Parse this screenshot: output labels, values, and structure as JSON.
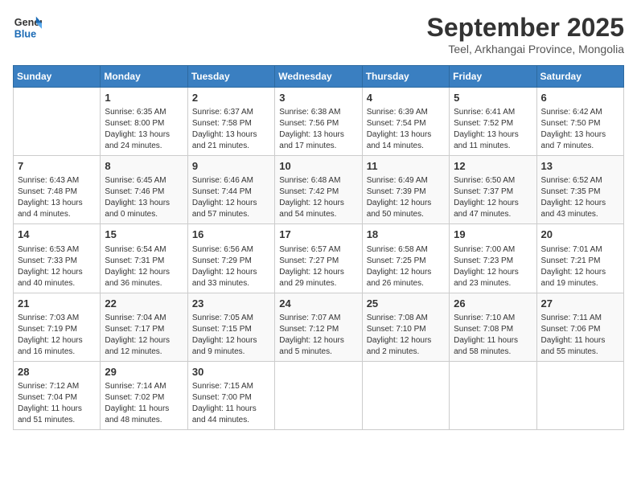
{
  "header": {
    "logo_line1": "General",
    "logo_line2": "Blue",
    "month_title": "September 2025",
    "location": "Teel, Arkhangai Province, Mongolia"
  },
  "weekdays": [
    "Sunday",
    "Monday",
    "Tuesday",
    "Wednesday",
    "Thursday",
    "Friday",
    "Saturday"
  ],
  "weeks": [
    [
      {
        "day": "",
        "info": ""
      },
      {
        "day": "1",
        "info": "Sunrise: 6:35 AM\nSunset: 8:00 PM\nDaylight: 13 hours\nand 24 minutes."
      },
      {
        "day": "2",
        "info": "Sunrise: 6:37 AM\nSunset: 7:58 PM\nDaylight: 13 hours\nand 21 minutes."
      },
      {
        "day": "3",
        "info": "Sunrise: 6:38 AM\nSunset: 7:56 PM\nDaylight: 13 hours\nand 17 minutes."
      },
      {
        "day": "4",
        "info": "Sunrise: 6:39 AM\nSunset: 7:54 PM\nDaylight: 13 hours\nand 14 minutes."
      },
      {
        "day": "5",
        "info": "Sunrise: 6:41 AM\nSunset: 7:52 PM\nDaylight: 13 hours\nand 11 minutes."
      },
      {
        "day": "6",
        "info": "Sunrise: 6:42 AM\nSunset: 7:50 PM\nDaylight: 13 hours\nand 7 minutes."
      }
    ],
    [
      {
        "day": "7",
        "info": "Sunrise: 6:43 AM\nSunset: 7:48 PM\nDaylight: 13 hours\nand 4 minutes."
      },
      {
        "day": "8",
        "info": "Sunrise: 6:45 AM\nSunset: 7:46 PM\nDaylight: 13 hours\nand 0 minutes."
      },
      {
        "day": "9",
        "info": "Sunrise: 6:46 AM\nSunset: 7:44 PM\nDaylight: 12 hours\nand 57 minutes."
      },
      {
        "day": "10",
        "info": "Sunrise: 6:48 AM\nSunset: 7:42 PM\nDaylight: 12 hours\nand 54 minutes."
      },
      {
        "day": "11",
        "info": "Sunrise: 6:49 AM\nSunset: 7:39 PM\nDaylight: 12 hours\nand 50 minutes."
      },
      {
        "day": "12",
        "info": "Sunrise: 6:50 AM\nSunset: 7:37 PM\nDaylight: 12 hours\nand 47 minutes."
      },
      {
        "day": "13",
        "info": "Sunrise: 6:52 AM\nSunset: 7:35 PM\nDaylight: 12 hours\nand 43 minutes."
      }
    ],
    [
      {
        "day": "14",
        "info": "Sunrise: 6:53 AM\nSunset: 7:33 PM\nDaylight: 12 hours\nand 40 minutes."
      },
      {
        "day": "15",
        "info": "Sunrise: 6:54 AM\nSunset: 7:31 PM\nDaylight: 12 hours\nand 36 minutes."
      },
      {
        "day": "16",
        "info": "Sunrise: 6:56 AM\nSunset: 7:29 PM\nDaylight: 12 hours\nand 33 minutes."
      },
      {
        "day": "17",
        "info": "Sunrise: 6:57 AM\nSunset: 7:27 PM\nDaylight: 12 hours\nand 29 minutes."
      },
      {
        "day": "18",
        "info": "Sunrise: 6:58 AM\nSunset: 7:25 PM\nDaylight: 12 hours\nand 26 minutes."
      },
      {
        "day": "19",
        "info": "Sunrise: 7:00 AM\nSunset: 7:23 PM\nDaylight: 12 hours\nand 23 minutes."
      },
      {
        "day": "20",
        "info": "Sunrise: 7:01 AM\nSunset: 7:21 PM\nDaylight: 12 hours\nand 19 minutes."
      }
    ],
    [
      {
        "day": "21",
        "info": "Sunrise: 7:03 AM\nSunset: 7:19 PM\nDaylight: 12 hours\nand 16 minutes."
      },
      {
        "day": "22",
        "info": "Sunrise: 7:04 AM\nSunset: 7:17 PM\nDaylight: 12 hours\nand 12 minutes."
      },
      {
        "day": "23",
        "info": "Sunrise: 7:05 AM\nSunset: 7:15 PM\nDaylight: 12 hours\nand 9 minutes."
      },
      {
        "day": "24",
        "info": "Sunrise: 7:07 AM\nSunset: 7:12 PM\nDaylight: 12 hours\nand 5 minutes."
      },
      {
        "day": "25",
        "info": "Sunrise: 7:08 AM\nSunset: 7:10 PM\nDaylight: 12 hours\nand 2 minutes."
      },
      {
        "day": "26",
        "info": "Sunrise: 7:10 AM\nSunset: 7:08 PM\nDaylight: 11 hours\nand 58 minutes."
      },
      {
        "day": "27",
        "info": "Sunrise: 7:11 AM\nSunset: 7:06 PM\nDaylight: 11 hours\nand 55 minutes."
      }
    ],
    [
      {
        "day": "28",
        "info": "Sunrise: 7:12 AM\nSunset: 7:04 PM\nDaylight: 11 hours\nand 51 minutes."
      },
      {
        "day": "29",
        "info": "Sunrise: 7:14 AM\nSunset: 7:02 PM\nDaylight: 11 hours\nand 48 minutes."
      },
      {
        "day": "30",
        "info": "Sunrise: 7:15 AM\nSunset: 7:00 PM\nDaylight: 11 hours\nand 44 minutes."
      },
      {
        "day": "",
        "info": ""
      },
      {
        "day": "",
        "info": ""
      },
      {
        "day": "",
        "info": ""
      },
      {
        "day": "",
        "info": ""
      }
    ]
  ]
}
